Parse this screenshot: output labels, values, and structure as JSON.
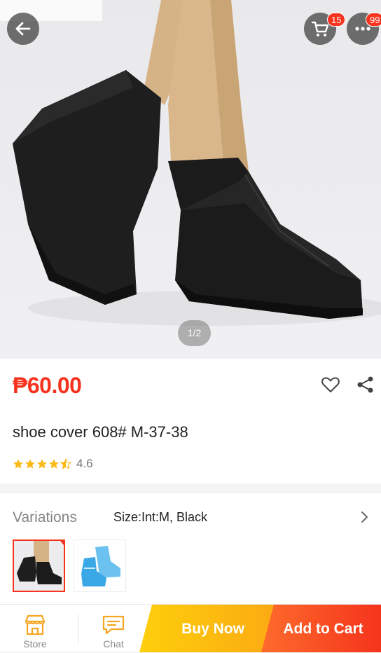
{
  "header": {
    "cart_badge": "15",
    "more_badge": "99"
  },
  "gallery": {
    "pager": "1/2"
  },
  "product": {
    "price": "₱60.00",
    "title": "shoe cover 608# M-37-38",
    "rating_value": "4.6",
    "rating_stars": 4.5
  },
  "variations": {
    "label": "Variations",
    "value": "Size:Int:M, Black"
  },
  "bottom_bar": {
    "store_label": "Store",
    "chat_label": "Chat",
    "buy_now_label": "Buy Now",
    "add_to_cart_label": "Add to Cart"
  },
  "colors": {
    "accent_red": "#f5331e",
    "buy_now_yellow": "#fdcf0b",
    "add_to_cart_orange": "#fd6b2c",
    "star_yellow": "#fcb814",
    "icon_orange": "#f5a623"
  },
  "icons": {
    "back": "arrow-left-icon",
    "cart": "cart-icon",
    "more": "more-dots-icon",
    "wishlist": "heart-icon",
    "share": "share-icon",
    "store": "store-icon",
    "chat": "chat-icon",
    "chevron": "chevron-right-icon"
  }
}
